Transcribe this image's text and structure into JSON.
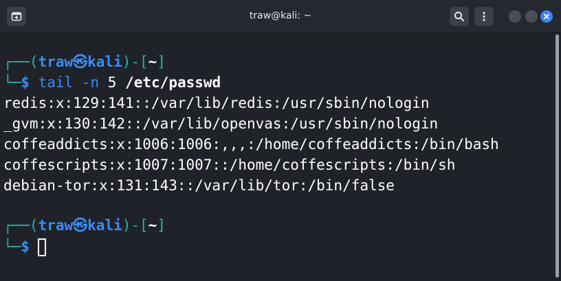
{
  "window": {
    "title": "traw@kali: ~"
  },
  "icons": {
    "new_tab": "new-tab-icon",
    "search": "search-icon",
    "menu": "kebab-menu-icon",
    "close": "close-icon"
  },
  "colors": {
    "prompt_bracket": "#2bb2a7",
    "prompt_user": "#3a8cf5",
    "close_button": "#3b82f6"
  },
  "terminal": {
    "prompt1": {
      "corner_top": "┌──(",
      "user": "traw",
      "host": "kali",
      "bracket_mid": ")-[",
      "path": "~",
      "bracket_end": "]",
      "corner_bottom": "└─",
      "dollar": "$",
      "cmd_name": "tail",
      "cmd_flag": "-n",
      "cmd_num": "5",
      "cmd_arg": "/etc/passwd"
    },
    "output": [
      "redis:x:129:141::/var/lib/redis:/usr/sbin/nologin",
      "_gvm:x:130:142::/var/lib/openvas:/usr/sbin/nologin",
      "coffeaddicts:x:1006:1006:,,,:/home/coffeaddicts:/bin/bash",
      "coffescripts:x:1007:1007::/home/coffescripts:/bin/sh",
      "debian-tor:x:131:143::/var/lib/tor:/bin/false"
    ],
    "prompt2": {
      "corner_top": "┌──(",
      "user": "traw",
      "host": "kali",
      "bracket_mid": ")-[",
      "path": "~",
      "bracket_end": "]",
      "corner_bottom": "└─",
      "dollar": "$"
    }
  }
}
